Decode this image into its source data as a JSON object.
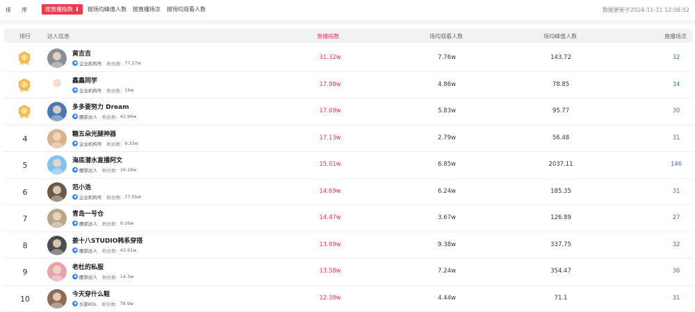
{
  "sort_bar": {
    "label_1": "排",
    "label_2": "序",
    "tabs": [
      {
        "label": "按直播指数",
        "active": true
      },
      {
        "label": "按场均峰值人数",
        "active": false
      },
      {
        "label": "按直播场次",
        "active": false
      },
      {
        "label": "按场均观看人数",
        "active": false
      }
    ],
    "update_time": "数据更新于2024-11-11 12:06:52"
  },
  "table": {
    "headers": {
      "rank": "排行",
      "influencer": "达人信息",
      "heat_index": "直播指数",
      "avg_viewers": "场均观看人数",
      "avg_peak": "场均峰值人数",
      "sessions": "直播场次"
    },
    "fans_label": "粉丝数:",
    "colors": {
      "accent_red": "#f0384e",
      "link_blue": "#3b6fd8",
      "badge_blue": "#3d8bf2",
      "medal_gold": "#f2b54a"
    },
    "rows": [
      {
        "rank": "1",
        "medal": true,
        "name": "黄吉吉",
        "tag": "企业机构号",
        "fans": "77.27w",
        "heat": "31.32w",
        "avg_view": "7.76w",
        "peak": "143.72",
        "sessions": "32",
        "avatar_color": "#8a8f96"
      },
      {
        "rank": "2",
        "medal": true,
        "name": "鑫鑫同学",
        "tag": "企业机构号",
        "fans": "16w",
        "heat": "17.98w",
        "avg_view": "4.86w",
        "peak": "78.85",
        "sessions": "34",
        "avatar_color": "#ffffff"
      },
      {
        "rank": "3",
        "medal": true,
        "name": "多多要努力 Dream",
        "tag": "腰部达人",
        "fans": "42.96w",
        "heat": "17.69w",
        "avg_view": "5.83w",
        "peak": "95.77",
        "sessions": "30",
        "avatar_color": "#4a78b5"
      },
      {
        "rank": "4",
        "medal": false,
        "name": "糖五朵光腿神器",
        "tag": "企业机构号",
        "fans": "9.33w",
        "heat": "17.13w",
        "avg_view": "2.79w",
        "peak": "56.48",
        "sessions": "31",
        "avatar_color": "#d8b48e"
      },
      {
        "rank": "5",
        "medal": false,
        "name": "海底潜水直播阿文",
        "tag": "腰部达人",
        "fans": "16.18w",
        "heat": "15.01w",
        "avg_view": "6.85w",
        "peak": "2037.11",
        "sessions": "146",
        "avatar_color": "#7fc3e8"
      },
      {
        "rank": "6",
        "medal": false,
        "name": "范小浩",
        "tag": "企业机构号",
        "fans": "77.55w",
        "heat": "14.69w",
        "avg_view": "6.24w",
        "peak": "185.35",
        "sessions": "31",
        "avatar_color": "#6b5a48"
      },
      {
        "rank": "7",
        "medal": false,
        "name": "青岛一号仓",
        "tag": "腰部达人",
        "fans": "9.16w",
        "heat": "14.47w",
        "avg_view": "3.67w",
        "peak": "126.89",
        "sessions": "27",
        "avatar_color": "#b9a58c"
      },
      {
        "rank": "8",
        "medal": false,
        "name": "姜十八STUDIO韩系穿搭",
        "tag": "腰部达人",
        "fans": "43.91w",
        "heat": "13.69w",
        "avg_view": "9.38w",
        "peak": "337.75",
        "sessions": "32",
        "avatar_color": "#4d4d4d"
      },
      {
        "rank": "9",
        "medal": false,
        "name": "老杜的私服",
        "tag": "腰部达人",
        "fans": "14.3w",
        "heat": "13.58w",
        "avg_view": "7.24w",
        "peak": "354.47",
        "sessions": "36",
        "avatar_color": "#e6a3ad"
      },
      {
        "rank": "10",
        "medal": false,
        "name": "今天穿什么鞋",
        "tag": "头部KOL",
        "fans": "78.9w",
        "heat": "12.38w",
        "avg_view": "4.44w",
        "peak": "71.1",
        "sessions": "31",
        "avatar_color": "#8c6d55"
      }
    ]
  }
}
